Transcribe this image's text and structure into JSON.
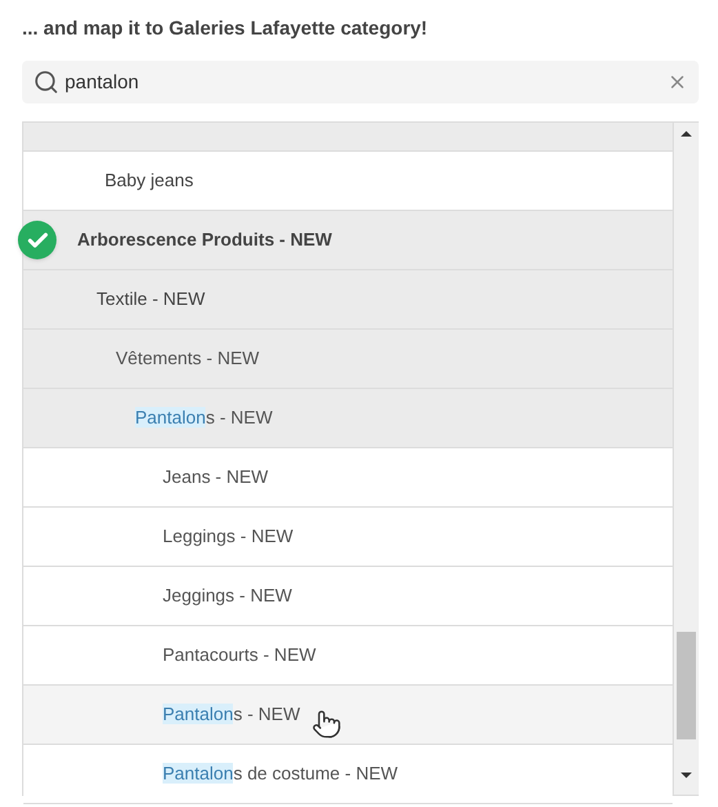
{
  "heading": "... and map it to Galeries Lafayette category!",
  "search": {
    "value": "pantalon"
  },
  "tree": [
    {
      "kind": "branch",
      "checked": false,
      "hovered": false,
      "children": [
        {
          "kind": "leaf",
          "label": "Baby jeans",
          "checked": false,
          "hovered": false
        }
      ]
    },
    {
      "kind": "branch",
      "label": "Arborescence Produits - NEW",
      "checked": true,
      "hovered": false,
      "children": [
        {
          "kind": "branch",
          "label": "Textile - NEW",
          "checked": false,
          "hovered": false,
          "children": [
            {
              "kind": "branch",
              "label": "Vêtements - NEW",
              "checked": false,
              "hovered": false,
              "children": [
                {
                  "kind": "branch",
                  "highlight": "Pantalon",
                  "label": "s - NEW",
                  "checked": false,
                  "hovered": false,
                  "children": [
                    {
                      "kind": "leaf",
                      "label": "Jeans - NEW",
                      "checked": false,
                      "hovered": false
                    },
                    {
                      "kind": "leaf",
                      "label": "Leggings - NEW",
                      "checked": false,
                      "hovered": false
                    },
                    {
                      "kind": "leaf",
                      "label": "Jeggings - NEW",
                      "checked": false,
                      "hovered": false
                    },
                    {
                      "kind": "leaf",
                      "label": "Pantacourts - NEW",
                      "checked": false,
                      "hovered": false
                    },
                    {
                      "kind": "leaf",
                      "highlight": "Pantalon",
                      "label": "s - NEW",
                      "checked": false,
                      "hovered": true
                    },
                    {
                      "kind": "leaf",
                      "highlight": "Pantalon",
                      "label": "s de costume - NEW",
                      "checked": false,
                      "hovered": false
                    }
                  ]
                }
              ]
            }
          ]
        }
      ]
    }
  ]
}
